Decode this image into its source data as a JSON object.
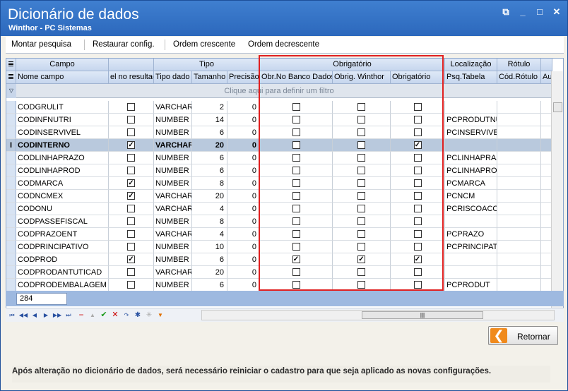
{
  "window": {
    "title": "Dicionário de dados",
    "subtitle": "Winthor - PC Sistemas"
  },
  "toolbar": {
    "montar": "Montar pesquisa",
    "restaurar": "Restaurar config.",
    "crescente": "Ordem crescente",
    "decrescente": "Ordem decrescente"
  },
  "groups": {
    "campo": "Campo",
    "tipo": "Tipo",
    "obrigatorio": "Obrigatório",
    "localizacao": "Localização",
    "rotulo": "Rótulo"
  },
  "columns": [
    "Nome campo",
    "el no resultad",
    "Tipo dado",
    "Tamanho",
    "Precisão",
    "Obr.No Banco Dados",
    "Obrig. Winthor",
    "Obrigatório",
    "Psq.Tabela",
    "Cód.Rótulo",
    "Au"
  ],
  "filter_text": "Clique aqui para definir um filtro",
  "rows": [
    {
      "nome": "CODGRULIT",
      "res": false,
      "tipo": "VARCHAR",
      "tam": "2",
      "prec": "0",
      "obd": false,
      "ow": false,
      "ob": false,
      "psq": ""
    },
    {
      "nome": "CODINFNUTRI",
      "res": false,
      "tipo": "NUMBER",
      "tam": "14",
      "prec": "0",
      "obd": false,
      "ow": false,
      "ob": false,
      "psq": "PCPRODUTNUT"
    },
    {
      "nome": "CODINSERVIVEL",
      "res": false,
      "tipo": "NUMBER",
      "tam": "6",
      "prec": "0",
      "obd": false,
      "ow": false,
      "ob": false,
      "psq": "PCINSERVIVEL"
    },
    {
      "nome": "CODINTERNO",
      "res": true,
      "tipo": "VARCHAR",
      "tam": "20",
      "prec": "0",
      "obd": false,
      "ow": false,
      "ob": true,
      "psq": "",
      "selected": true
    },
    {
      "nome": "CODLINHAPRAZO",
      "res": false,
      "tipo": "NUMBER",
      "tam": "6",
      "prec": "0",
      "obd": false,
      "ow": false,
      "ob": false,
      "psq": "PCLINHAPRAZO"
    },
    {
      "nome": "CODLINHAPROD",
      "res": false,
      "tipo": "NUMBER",
      "tam": "6",
      "prec": "0",
      "obd": false,
      "ow": false,
      "ob": false,
      "psq": "PCLINHAPROD"
    },
    {
      "nome": "CODMARCA",
      "res": true,
      "tipo": "NUMBER",
      "tam": "8",
      "prec": "0",
      "obd": false,
      "ow": false,
      "ob": false,
      "psq": "PCMARCA"
    },
    {
      "nome": "CODNCMEX",
      "res": true,
      "tipo": "VARCHAR",
      "tam": "20",
      "prec": "0",
      "obd": false,
      "ow": false,
      "ob": false,
      "psq": "PCNCM"
    },
    {
      "nome": "CODONU",
      "res": false,
      "tipo": "VARCHAR",
      "tam": "4",
      "prec": "0",
      "obd": false,
      "ow": false,
      "ob": false,
      "psq": "PCRISCOACON"
    },
    {
      "nome": "CODPASSEFISCAL",
      "res": false,
      "tipo": "NUMBER",
      "tam": "8",
      "prec": "0",
      "obd": false,
      "ow": false,
      "ob": false,
      "psq": ""
    },
    {
      "nome": "CODPRAZOENT",
      "res": false,
      "tipo": "VARCHAR",
      "tam": "4",
      "prec": "0",
      "obd": false,
      "ow": false,
      "ob": false,
      "psq": "PCPRAZO"
    },
    {
      "nome": "CODPRINCIPATIVO",
      "res": false,
      "tipo": "NUMBER",
      "tam": "10",
      "prec": "0",
      "obd": false,
      "ow": false,
      "ob": false,
      "psq": "PCPRINCIPATI"
    },
    {
      "nome": "CODPROD",
      "res": true,
      "tipo": "NUMBER",
      "tam": "6",
      "prec": "0",
      "obd": true,
      "ow": true,
      "ob": true,
      "psq": ""
    },
    {
      "nome": "CODPRODANTUTICAD",
      "res": false,
      "tipo": "VARCHAR",
      "tam": "20",
      "prec": "0",
      "obd": false,
      "ow": false,
      "ob": false,
      "psq": ""
    },
    {
      "nome": "CODPRODEMBALAGEM",
      "res": false,
      "tipo": "NUMBER",
      "tam": "6",
      "prec": "0",
      "obd": false,
      "ow": false,
      "ob": false,
      "psq": "PCPRODUT"
    }
  ],
  "record_count": "284",
  "buttons": {
    "retornar": "Retornar"
  },
  "footer": "Após alteração no dicionário de dados, será necessário reiniciar o cadastro para que seja aplicado as novas configurações.",
  "highlight_color": "#e02020"
}
